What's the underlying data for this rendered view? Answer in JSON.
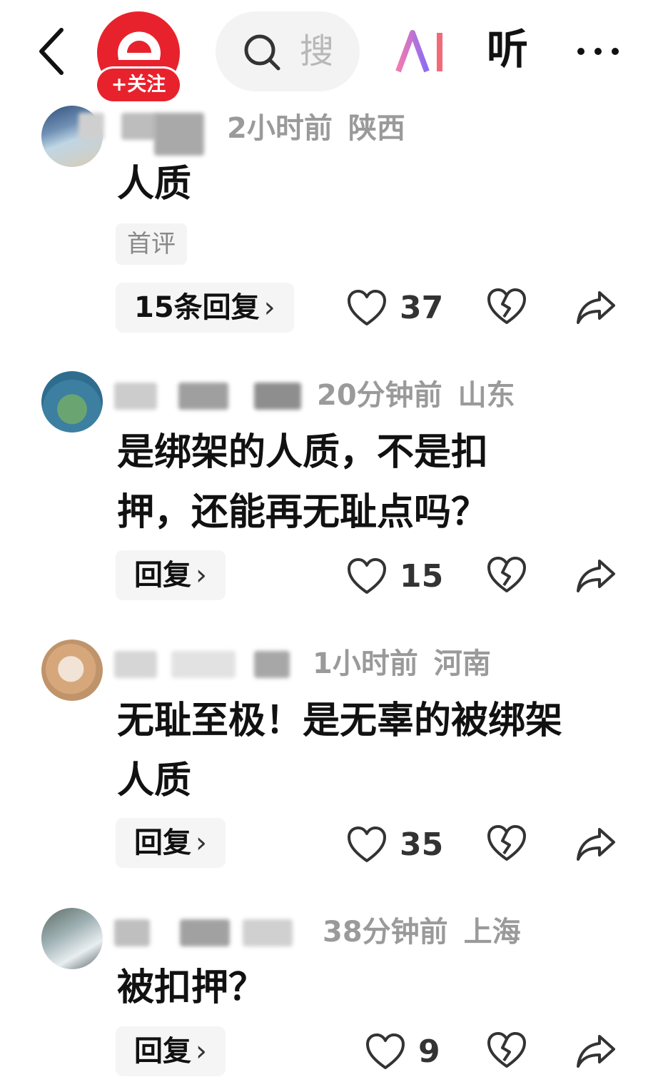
{
  "header": {
    "follow_label": "+关注",
    "search_placeholder": "搜",
    "ai_label": "AI",
    "listen_label": "听"
  },
  "comments": [
    {
      "time": "2小时前",
      "location": "陕西",
      "text": "人质",
      "tag": "首评",
      "reply_label": "15条回复",
      "likes": "37"
    },
    {
      "time": "20分钟前",
      "location": "山东",
      "text": "是绑架的人质，不是扣押，还能再无耻点吗？",
      "reply_label": "回复",
      "likes": "15"
    },
    {
      "time": "1小时前",
      "location": "河南",
      "text": "无耻至极！是无辜的被绑架人质",
      "reply_label": "回复",
      "likes": "35"
    },
    {
      "time": "38分钟前",
      "location": "上海",
      "text": "被扣押？",
      "reply_label": "回复",
      "likes": "9"
    }
  ],
  "colors": {
    "brand_red": "#e8222d",
    "ai_gradient_start": "#f47ab0",
    "ai_gradient_end": "#8a6cf5",
    "meta_gray": "#9a9a9a"
  },
  "icons": [
    "back-icon",
    "logo-icon",
    "search-icon",
    "ai-icon",
    "more-icon",
    "heart-icon",
    "broken-heart-icon",
    "share-icon",
    "chevron-right-icon"
  ]
}
